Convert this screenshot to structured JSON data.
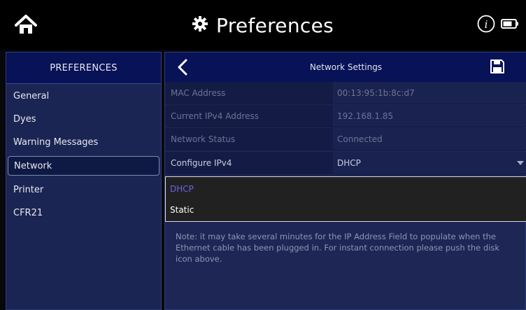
{
  "header": {
    "title": "Preferences",
    "icons": {
      "home": "home-icon",
      "title": "gear-icon",
      "info": "info-icon",
      "battery": "battery-icon"
    }
  },
  "sidebar": {
    "title": "PREFERENCES",
    "items": [
      {
        "label": "General",
        "active": false
      },
      {
        "label": "Dyes",
        "active": false
      },
      {
        "label": "Warning Messages",
        "active": false
      },
      {
        "label": "Network",
        "active": true
      },
      {
        "label": "Printer",
        "active": false
      },
      {
        "label": "CFR21",
        "active": false
      }
    ]
  },
  "main": {
    "title": "Network Settings",
    "icons": {
      "back": "chevron-left-icon",
      "save": "save-disk-icon"
    },
    "rows": [
      {
        "label": "MAC Address",
        "value": "00:13:95:1b:8c:d7"
      },
      {
        "label": "Current IPv4 Address",
        "value": "192.168.1.85"
      },
      {
        "label": "Network Status",
        "value": "Connected"
      },
      {
        "label": "Configure IPv4",
        "value": "DHCP"
      }
    ],
    "dropdown": {
      "options": [
        {
          "label": "DHCP",
          "selected": true
        },
        {
          "label": "Static",
          "selected": false
        }
      ],
      "selected_color": "#6b63e8"
    },
    "note": "Note: it may take several minutes for the IP Address Field to populate when the Ethernet cable has been plugged in. For instant connection please push the disk icon above."
  },
  "colors": {
    "accent": "#071257",
    "panel": "#1b2553",
    "background": "#000000"
  }
}
